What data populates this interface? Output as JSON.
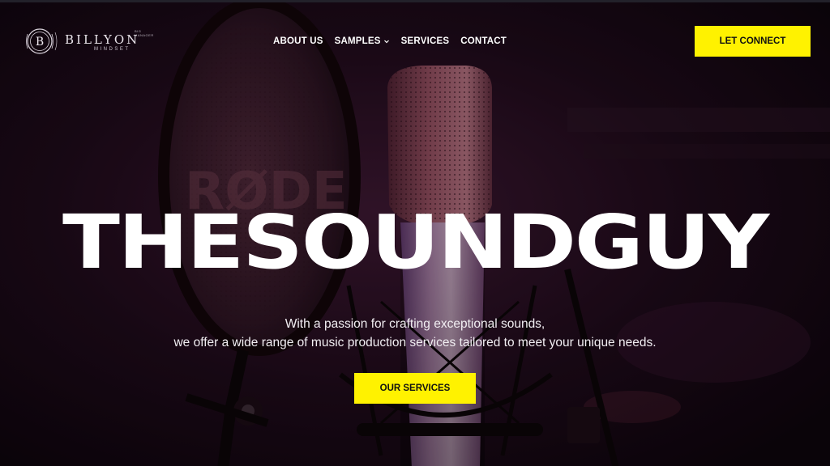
{
  "brand": {
    "name": "BILLYON",
    "tagline": "MINDSET",
    "tiny_text": "BIG MANAGER",
    "badge_letter": "B"
  },
  "nav": {
    "items": [
      {
        "label": "ABOUT US"
      },
      {
        "label": "SAMPLES",
        "has_dropdown": true
      },
      {
        "label": "SERVICES"
      },
      {
        "label": "CONTACT"
      }
    ]
  },
  "header": {
    "cta_label": "LET CONNECT"
  },
  "hero": {
    "title": "THESOUNDGUY",
    "line1": "With a passion for crafting exceptional sounds,",
    "line2": "we offer a wide range of music production services tailored to meet your unique needs.",
    "cta_label": "OUR SERVICES",
    "mic_brand_text": "RØDE"
  },
  "colors": {
    "accent": "#fff200",
    "background": "#120610",
    "text": "#ffffff"
  },
  "icons": {
    "dropdown": "chevron-down-icon",
    "logo": "logo-badge-icon"
  }
}
